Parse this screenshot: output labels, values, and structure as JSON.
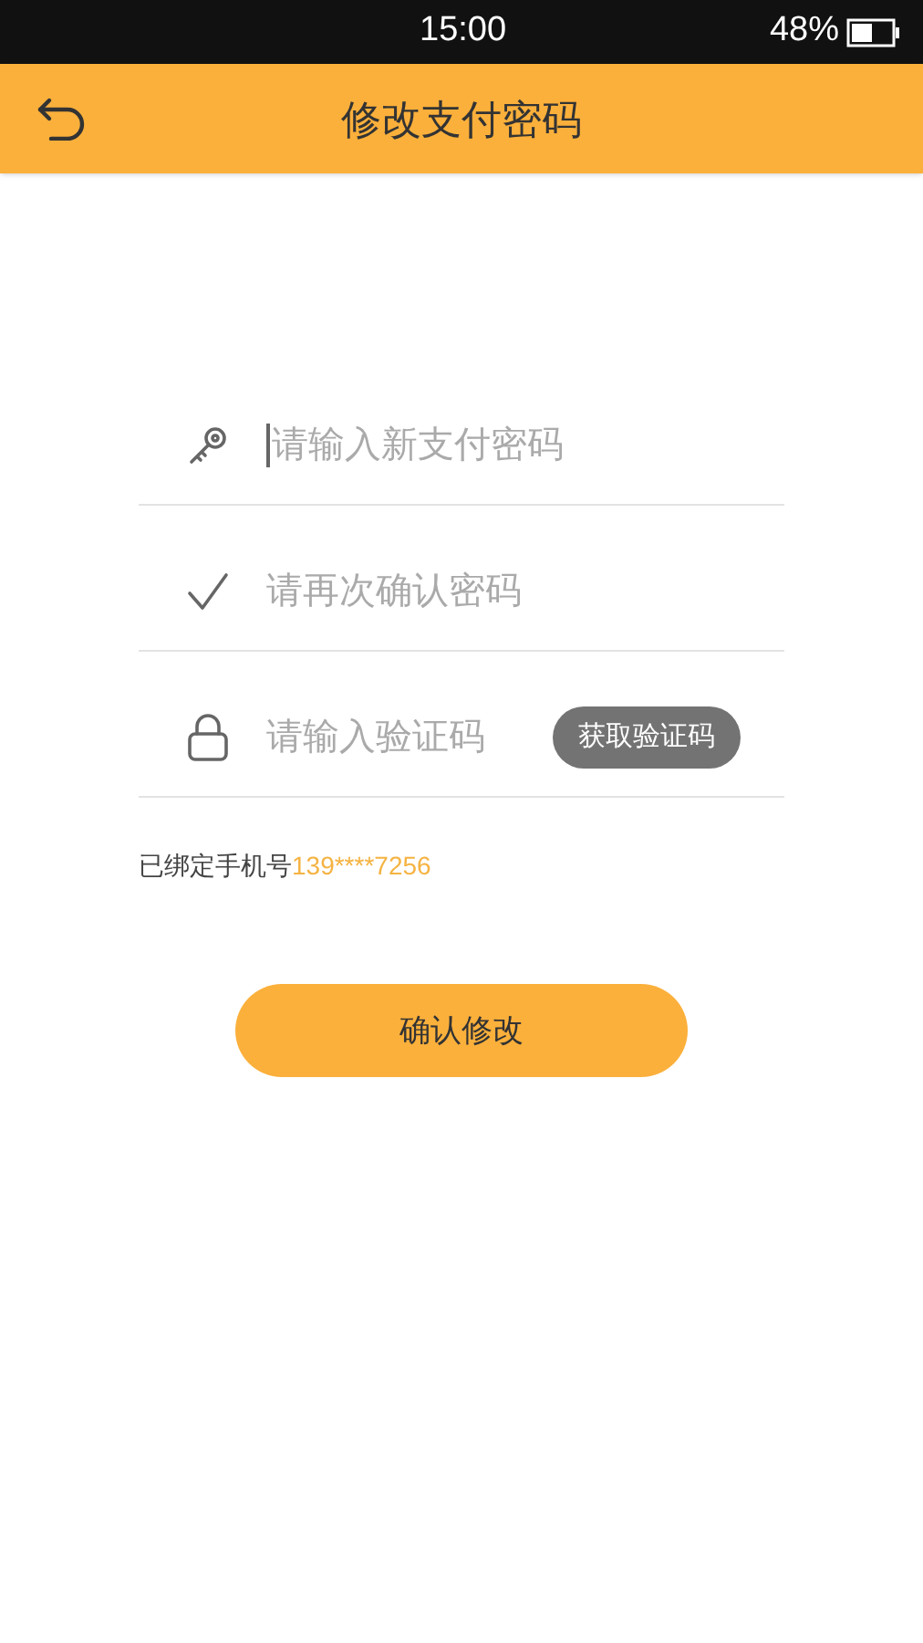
{
  "status_bar": {
    "time": "15:00",
    "battery": "48%"
  },
  "header": {
    "title": "修改支付密码"
  },
  "fields": [
    {
      "kind": "key",
      "placeholder": "请输入新支付密码",
      "focused": true
    },
    {
      "kind": "check",
      "placeholder": "请再次确认密码",
      "focused": false
    },
    {
      "kind": "lock",
      "placeholder": "请输入验证码",
      "focused": false,
      "button": "获取验证码"
    }
  ],
  "bound_phone": {
    "label": "已绑定手机号",
    "phone": "139****7256"
  },
  "submit_button": "确认修改"
}
